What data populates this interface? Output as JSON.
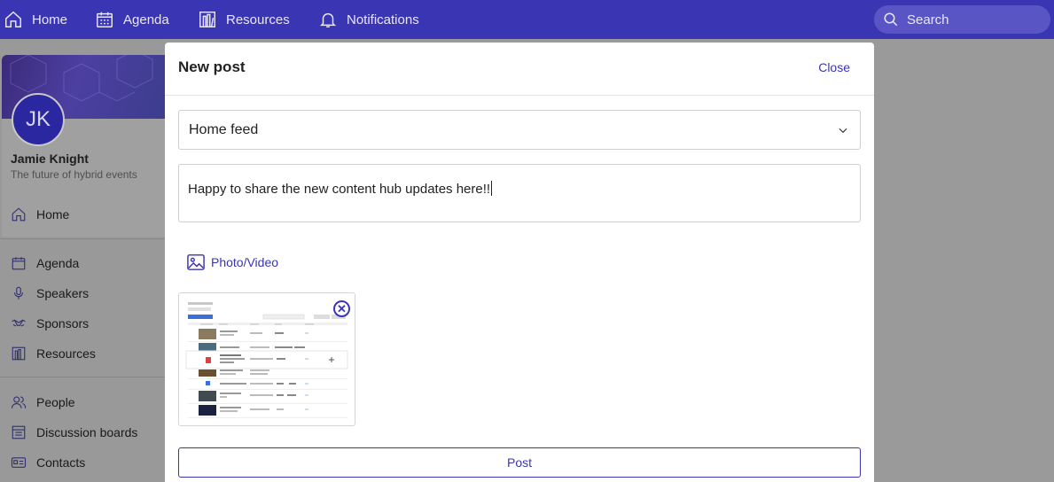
{
  "topnav": {
    "items": [
      {
        "label": "Home",
        "icon": "home-icon"
      },
      {
        "label": "Agenda",
        "icon": "calendar-icon"
      },
      {
        "label": "Resources",
        "icon": "resources-icon"
      },
      {
        "label": "Notifications",
        "icon": "bell-icon"
      }
    ],
    "search_placeholder": "Search"
  },
  "profile": {
    "initials": "JK",
    "name": "Jamie Knight",
    "tagline": "The future of hybrid events"
  },
  "sidebar": {
    "items": [
      {
        "label": "Home",
        "icon": "home-icon"
      },
      {
        "label": "Agenda",
        "icon": "calendar-icon"
      },
      {
        "label": "Speakers",
        "icon": "microphone-icon"
      },
      {
        "label": "Sponsors",
        "icon": "handshake-icon"
      },
      {
        "label": "Resources",
        "icon": "resources-icon"
      },
      {
        "label": "People",
        "icon": "people-icon"
      },
      {
        "label": "Discussion boards",
        "icon": "discussion-icon"
      },
      {
        "label": "Contacts",
        "icon": "contact-card-icon"
      }
    ]
  },
  "modal": {
    "title": "New post",
    "close_label": "Close",
    "feed_selected": "Home feed",
    "post_text": "Happy to share the new content hub updates here!!",
    "photo_video_label": "Photo/Video",
    "remove_attachment_icon": "close-circle-icon",
    "post_label": "Post"
  },
  "colors": {
    "brand": "#3a35b3",
    "overlay": "#9a9a9a",
    "modal_bg": "#ffffff"
  }
}
